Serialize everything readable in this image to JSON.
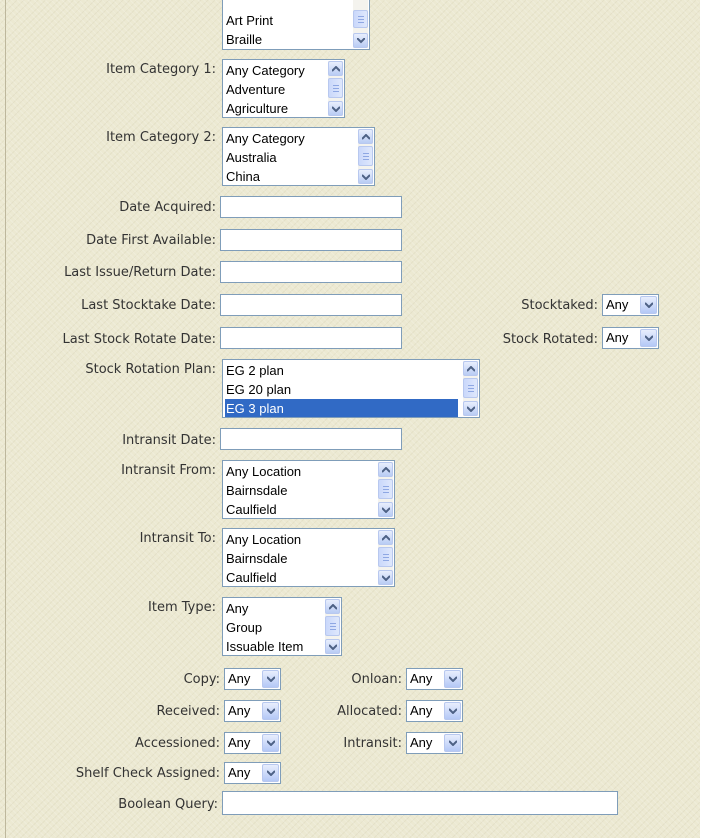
{
  "form": {
    "format_list": {
      "options": [
        "Art Print",
        "Braille"
      ]
    },
    "item_category_1": {
      "label": "Item Category 1:",
      "options": [
        "Any Category",
        "Adventure",
        "Agriculture"
      ]
    },
    "item_category_2": {
      "label": "Item Category 2:",
      "options": [
        "Any Category",
        "Australia",
        "China"
      ]
    },
    "date_acquired": {
      "label": "Date Acquired:",
      "value": ""
    },
    "date_first_available": {
      "label": "Date First Available:",
      "value": ""
    },
    "last_issue_return_date": {
      "label": "Last Issue/Return Date:",
      "value": ""
    },
    "last_stocktake_date": {
      "label": "Last Stocktake Date:",
      "value": ""
    },
    "stocktaked": {
      "label": "Stocktaked:",
      "value": "Any"
    },
    "last_stock_rotate_date": {
      "label": "Last Stock Rotate Date:",
      "value": ""
    },
    "stock_rotated": {
      "label": "Stock Rotated:",
      "value": "Any"
    },
    "stock_rotation_plan": {
      "label": "Stock Rotation Plan:",
      "options": [
        "EG 2 plan",
        "EG 20 plan",
        "EG 3 plan"
      ],
      "selected": "EG 3 plan"
    },
    "intransit_date": {
      "label": "Intransit Date:",
      "value": ""
    },
    "intransit_from": {
      "label": "Intransit From:",
      "options": [
        "Any Location",
        "Bairnsdale",
        "Caulfield"
      ]
    },
    "intransit_to": {
      "label": "Intransit To:",
      "options": [
        "Any Location",
        "Bairnsdale",
        "Caulfield"
      ]
    },
    "item_type": {
      "label": "Item Type:",
      "options": [
        "Any",
        "Group",
        "Issuable Item"
      ]
    },
    "copy": {
      "label": "Copy:",
      "value": "Any"
    },
    "onloan": {
      "label": "Onloan:",
      "value": "Any"
    },
    "received": {
      "label": "Received:",
      "value": "Any"
    },
    "allocated": {
      "label": "Allocated:",
      "value": "Any"
    },
    "accessioned": {
      "label": "Accessioned:",
      "value": "Any"
    },
    "intransit": {
      "label": "Intransit:",
      "value": "Any"
    },
    "shelf_check_assigned": {
      "label": "Shelf Check Assigned:",
      "value": "Any"
    },
    "boolean_query": {
      "label": "Boolean Query:",
      "value": ""
    }
  },
  "colors": {
    "panel_background": "#ece9d2",
    "label_text": "#333333",
    "selection": "#316ac5",
    "input_border": "#7f9db9"
  }
}
